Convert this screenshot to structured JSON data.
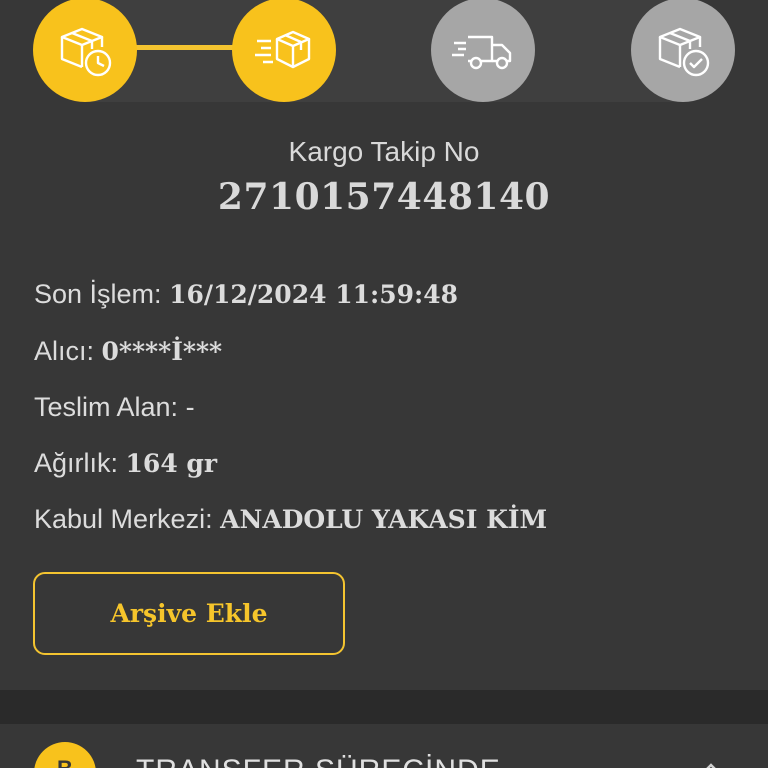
{
  "steps": [
    {
      "name": "package-clock-icon",
      "state": "active"
    },
    {
      "name": "package-moving-icon",
      "state": "active"
    },
    {
      "name": "delivery-truck-icon",
      "state": "inactive"
    },
    {
      "name": "package-check-icon",
      "state": "inactive"
    }
  ],
  "tracking": {
    "label": "Kargo Takip No",
    "number": "2710157448140"
  },
  "details": {
    "last_action_label": "Son İşlem: ",
    "last_action_value": "16/12/2024 11:59:48",
    "recipient_label": "Alıcı:  ",
    "recipient_value": "0****İ***",
    "delivered_to_label": "Teslim Alan: ",
    "delivered_to_value": "-",
    "weight_label": "Ağırlık: ",
    "weight_value": "164 gr",
    "acceptance_center_label": "Kabul Merkezi: ",
    "acceptance_center_value": "ANADOLU YAKASI KİM"
  },
  "archive_button": {
    "label": "Arşive Ekle"
  },
  "status_card": {
    "badge": "B",
    "title": "TRANSFER SÜRECİNDE",
    "expand_icon": "chevron-up-icon"
  },
  "colors": {
    "background": "#373737",
    "accent": "#f8c21c",
    "inactive": "#a6a6a6",
    "divider": "#2a2a2a"
  }
}
